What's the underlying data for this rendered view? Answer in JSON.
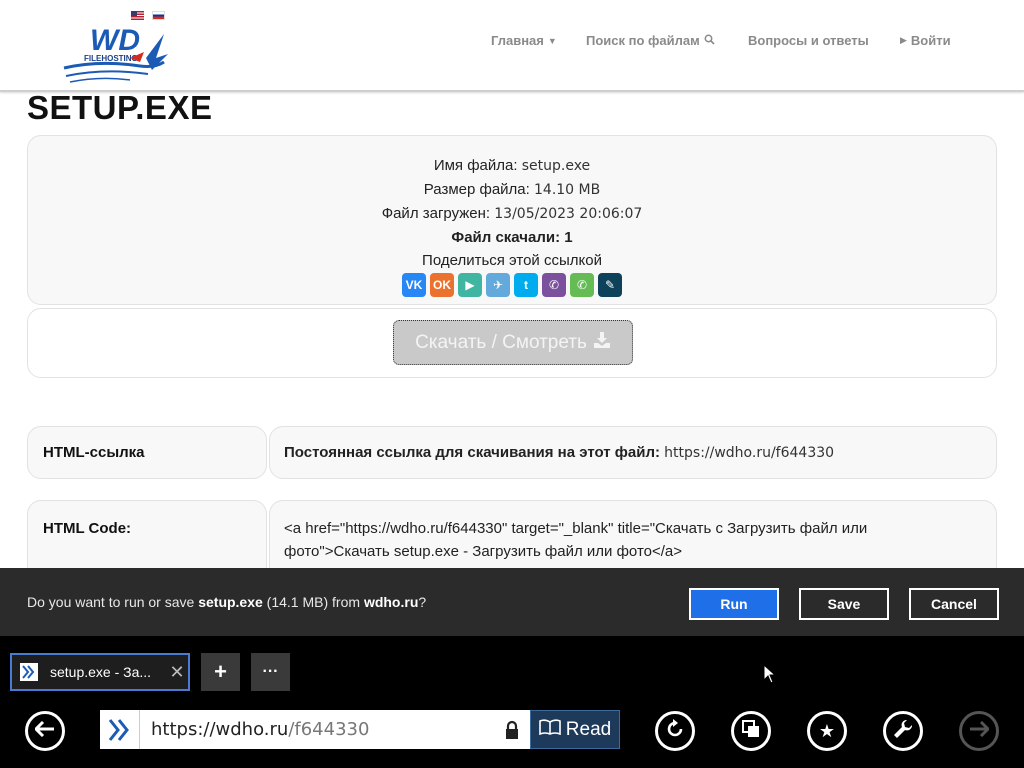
{
  "header": {
    "logo": {
      "text": "WD",
      "sub": "FILEHOSTING"
    },
    "nav": [
      {
        "label": "Главная",
        "icon": "caret-down-icon"
      },
      {
        "label": "Поиск по файлам",
        "icon": "search-icon"
      },
      {
        "label": "Вопросы и ответы",
        "icon": ""
      },
      {
        "label": "Войти",
        "icon": "caret-right-icon"
      }
    ]
  },
  "page": {
    "title": "SETUP.EXE",
    "info": {
      "name_label": "Имя файла:",
      "name_value": "setup.exe",
      "size_label": "Размер файла:",
      "size_value": "14.10 MB",
      "uploaded_label": "Файл загружен:",
      "uploaded_value": "13/05/2023 20:06:07",
      "downloads_label": "Файл скачали:",
      "downloads_value": "1",
      "share_label": "Поделиться этой ссылкой"
    },
    "share": [
      {
        "name": "vk",
        "glyph": "VK",
        "color": "#2787f5"
      },
      {
        "name": "odnoklassniki",
        "glyph": "OK",
        "color": "#eb722e"
      },
      {
        "name": "yandex-messenger",
        "glyph": "▶",
        "color": "#3fb5a2"
      },
      {
        "name": "telegram",
        "glyph": "✈",
        "color": "#64a9dc"
      },
      {
        "name": "twitter",
        "glyph": "t",
        "color": "#00aced"
      },
      {
        "name": "viber",
        "glyph": "✆",
        "color": "#7b519d"
      },
      {
        "name": "whatsapp",
        "glyph": "✆",
        "color": "#65bc54"
      },
      {
        "name": "livejournal",
        "glyph": "✎",
        "color": "#0d425a"
      }
    ],
    "download_button": "Скачать / Смотреть",
    "html_link": {
      "label": "HTML-ссылка",
      "prefix": "Постоянная ссылка для скачивания на этот файл:",
      "url": "https://wdho.ru/f644330"
    },
    "html_code": {
      "label": "HTML Code:",
      "code": "<a href=\"https://wdho.ru/f644330\" target=\"_blank\" title=\"Скачать с Загрузить файл или фото\">Скачать setup.exe - Загрузить файл или фото</a>"
    }
  },
  "download_bar": {
    "msg_prefix": "Do you want to run or save ",
    "file": "setup.exe",
    "size": " (14.1 MB) from ",
    "domain": "wdho.ru",
    "msg_suffix": "?",
    "run": "Run",
    "save": "Save",
    "cancel": "Cancel"
  },
  "tabs": {
    "active_title": "setup.exe - За...",
    "new_tab": "+",
    "more": "···"
  },
  "address": {
    "url_main": "https://wdho.ru",
    "url_path": "/f644330",
    "read": "Read"
  }
}
